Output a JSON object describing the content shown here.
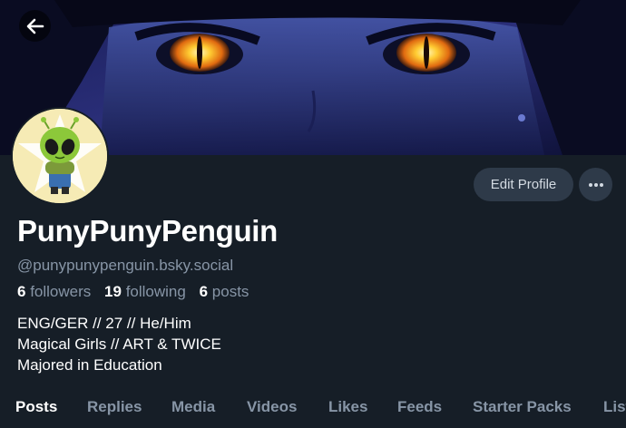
{
  "profile": {
    "display_name": "PunyPunyPenguin",
    "handle": "@punypunypenguin.bsky.social",
    "stats": {
      "followers_count": "6",
      "followers_label": "followers",
      "following_count": "19",
      "following_label": "following",
      "posts_count": "6",
      "posts_label": "posts"
    },
    "bio_lines": [
      "ENG/GER // 27 // He/Him",
      "Magical Girls // ART & TWICE",
      "Majored in Education"
    ]
  },
  "actions": {
    "edit_profile_label": "Edit Profile"
  },
  "tabs": [
    {
      "label": "Posts",
      "active": true
    },
    {
      "label": "Replies"
    },
    {
      "label": "Media"
    },
    {
      "label": "Videos"
    },
    {
      "label": "Likes"
    },
    {
      "label": "Feeds"
    },
    {
      "label": "Starter Packs"
    },
    {
      "label": "Lists"
    }
  ],
  "icons": {
    "back": "arrow-left-icon",
    "more": "ellipsis-icon"
  },
  "colors": {
    "background": "#161e27",
    "button": "#2e3a49",
    "muted_text": "#8795a6"
  }
}
